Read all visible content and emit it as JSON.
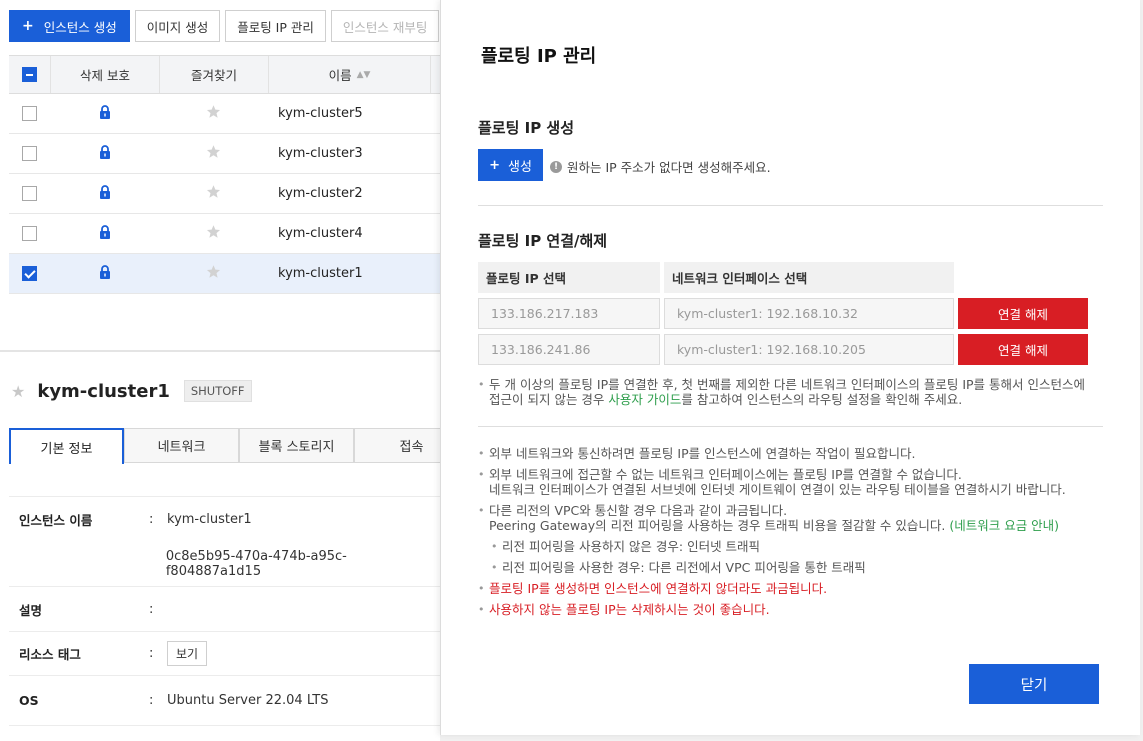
{
  "toolbar": {
    "create_instance": "인스턴스 생성",
    "create_image": "이미지 생성",
    "floating_ip": "플로팅 IP 관리",
    "reboot": "인스턴스 재부팅"
  },
  "grid": {
    "headers": {
      "delete_protect": "삭제 보호",
      "favorite": "즐겨찾기",
      "name": "이름"
    },
    "rows": [
      {
        "name": "kym-cluster5",
        "checked": false
      },
      {
        "name": "kym-cluster3",
        "checked": false
      },
      {
        "name": "kym-cluster2",
        "checked": false
      },
      {
        "name": "kym-cluster4",
        "checked": false
      },
      {
        "name": "kym-cluster1",
        "checked": true
      }
    ]
  },
  "detail": {
    "name": "kym-cluster1",
    "status": "SHUTOFF",
    "tabs": [
      "기본 정보",
      "네트워크",
      "블록 스토리지",
      "접속"
    ],
    "fields": {
      "instance_name_label": "인스턴스 이름",
      "instance_name": "kym-cluster1",
      "instance_id": "0c8e5b95-470a-474b-a95c-f804887a1d15",
      "description_label": "설명",
      "resource_tag_label": "리소스 태그",
      "resource_tag_button": "보기",
      "os_label": "OS",
      "os_value": "Ubuntu Server 22.04 LTS"
    },
    "colon": ":"
  },
  "modal": {
    "title": "플로팅 IP 관리",
    "create_section": "플로팅 IP 생성",
    "create_button": "생성",
    "create_hint": "원하는 IP 주소가 없다면 생성해주세요.",
    "connect_section": "플로팅 IP 연결/해제",
    "col_ip": "플로팅 IP 선택",
    "col_nic": "네트워크 인터페이스 선택",
    "connections": [
      {
        "ip": "133.186.217.183",
        "nic": "kym-cluster1: 192.168.10.32",
        "action": "연결 해제"
      },
      {
        "ip": "133.186.241.86",
        "nic": "kym-cluster1: 192.168.10.205",
        "action": "연결 해제"
      }
    ],
    "warning": {
      "line1": "두 개 이상의 플로팅 IP를 연결한 후, 첫 번째를 제외한 다른 네트워크 인터페이스의 플로팅 IP를 통해서 인스턴스에",
      "line2_pre": "접근이 되지 않는 경우 ",
      "line2_link": "사용자 가이드",
      "line2_post": "를 참고하여 인스턴스의 라우팅 설정을 확인해 주세요."
    },
    "notes": {
      "n1": "외부 네트워크와 통신하려면 플로팅 IP를 인스턴스에 연결하는 작업이 필요합니다.",
      "n2a": "외부 네트워크에 접근할 수 없는 네트워크 인터페이스에는 플로팅 IP를 연결할 수 없습니다.",
      "n2b": "네트워크 인터페이스가 연결된 서브넷에 인터넷 게이트웨이 연결이 있는 라우팅 테이블을 연결하시기 바랍니다.",
      "n3a": "다른 리전의 VPC와 통신할 경우 다음과 같이 과금됩니다.",
      "n3b_pre": "Peering Gateway의 리전 피어링을 사용하는 경우 트래픽 비용을 절감할 수 있습니다. ",
      "n3b_link": "(네트워크 요금 안내)",
      "s1": "리전 피어링을 사용하지 않은 경우: 인터넷 트래픽",
      "s2": "리전 피어링을 사용한 경우: 다른 리전에서 VPC 피어링을 통한 트래픽",
      "r1": "플로팅 IP를 생성하면 인스턴스에 연결하지 않더라도 과금됩니다.",
      "r2": "사용하지 않는 플로팅 IP는 삭제하시는 것이 좋습니다."
    },
    "close_button": "닫기"
  },
  "colors": {
    "primary": "#1a5fd8",
    "danger": "#d81e24",
    "link": "#2e9e4c"
  }
}
